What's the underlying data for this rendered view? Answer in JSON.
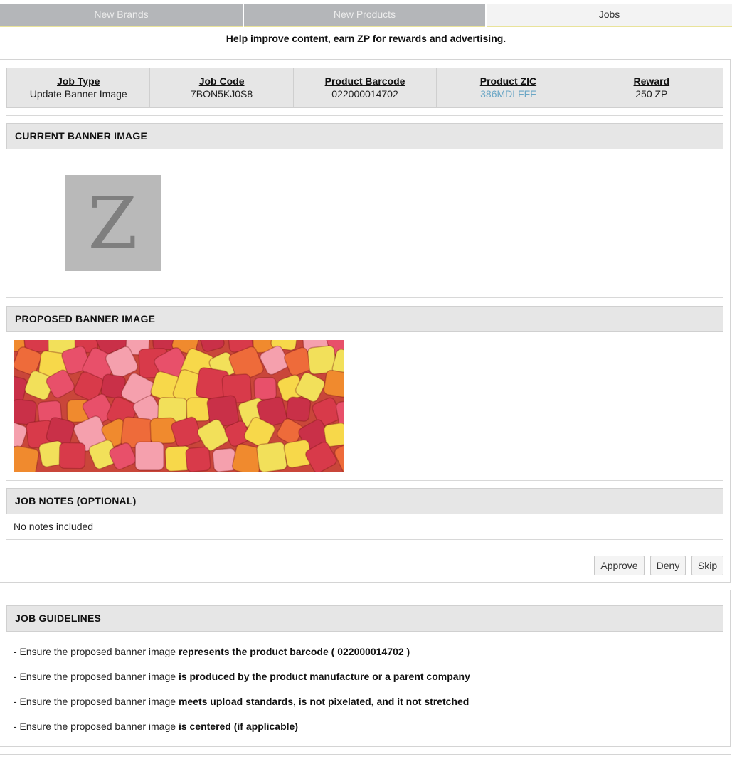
{
  "tabs": [
    {
      "label": "New Brands"
    },
    {
      "label": "New Products"
    },
    {
      "label": "Jobs"
    }
  ],
  "help_text": "Help improve content, earn ZP for rewards and advertising.",
  "job": {
    "columns": [
      {
        "header": "Job Type",
        "value": "Update Banner Image"
      },
      {
        "header": "Job Code",
        "value": "7BON5KJ0S8"
      },
      {
        "header": "Product Barcode",
        "value": "022000014702"
      },
      {
        "header": "Product ZIC",
        "value": "386MDLFFF"
      },
      {
        "header": "Reward",
        "value": "250 ZP"
      }
    ]
  },
  "current_banner": {
    "heading": "CURRENT BANNER IMAGE",
    "logo_letter": "Z"
  },
  "proposed_banner": {
    "heading": "PROPOSED BANNER IMAGE"
  },
  "notes": {
    "heading": "JOB NOTES (OPTIONAL)",
    "text": "No notes included"
  },
  "actions": {
    "approve": "Approve",
    "deny": "Deny",
    "skip": "Skip"
  },
  "guidelines": {
    "heading": "JOB GUIDELINES",
    "items": [
      {
        "prefix": "- Ensure the proposed banner image ",
        "bold": "represents the product barcode ( 022000014702 )"
      },
      {
        "prefix": "- Ensure the proposed banner image ",
        "bold": "is produced by the product manufacture or a parent company"
      },
      {
        "prefix": "- Ensure the proposed banner image ",
        "bold": "meets upload standards, is not pixelated, and it not stretched"
      },
      {
        "prefix": "- Ensure the proposed banner image ",
        "bold": "is centered (if applicable)"
      }
    ]
  },
  "colors": {
    "link": "#6aa6c5",
    "tab_accent": "#e9e39a",
    "section_bg": "#e6e6e6"
  }
}
